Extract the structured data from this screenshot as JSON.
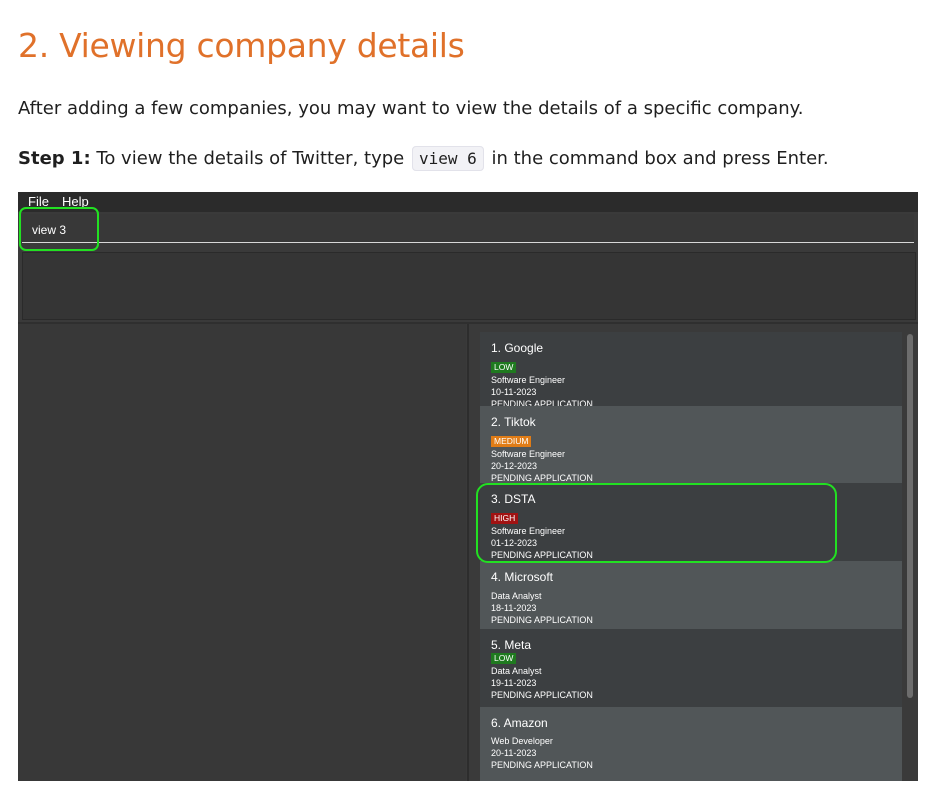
{
  "doc": {
    "title": "2. Viewing company details",
    "intro": "After adding a few companies, you may want to view the details of a specific company.",
    "step_label": "Step 1:",
    "step_text_before": " To view the details of Twitter, type ",
    "step_code": "view 6",
    "step_text_after": " in the command box and press Enter."
  },
  "app": {
    "menu": [
      "File",
      "Help"
    ],
    "command_value": "view 3",
    "highlight_color": "#22e022",
    "priority_colors": {
      "LOW": "#1f7a1f",
      "MEDIUM": "#e07c16",
      "HIGH": "#a11212"
    },
    "companies": [
      {
        "title": "1.  Google",
        "priority": "LOW",
        "role": "Software Engineer",
        "date": "10-11-2023",
        "status": "PENDING APPLICATION"
      },
      {
        "title": "2.  Tiktok",
        "priority": "MEDIUM",
        "role": "Software Engineer",
        "date": "20-12-2023",
        "status": "PENDING APPLICATION"
      },
      {
        "title": "3.  DSTA",
        "priority": "HIGH",
        "role": "Software Engineer",
        "date": "01-12-2023",
        "status": "PENDING APPLICATION"
      },
      {
        "title": "4.  Microsoft",
        "priority": "",
        "role": "Data Analyst",
        "date": "18-11-2023",
        "status": "PENDING APPLICATION"
      },
      {
        "title": "5.  Meta",
        "priority": "LOW",
        "role": "Data Analyst",
        "date": "19-11-2023",
        "status": "PENDING APPLICATION"
      },
      {
        "title": "6.  Amazon",
        "priority": "",
        "role": "Web Developer",
        "date": "20-11-2023",
        "status": "PENDING APPLICATION"
      }
    ]
  }
}
